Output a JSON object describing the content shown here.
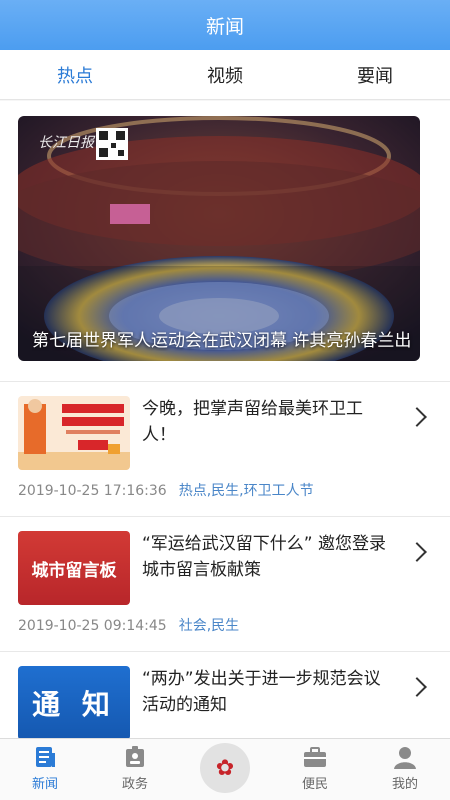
{
  "header": {
    "title": "新闻"
  },
  "tabs": [
    {
      "label": "热点",
      "active": true
    },
    {
      "label": "视频",
      "active": false
    },
    {
      "label": "要闻",
      "active": false
    }
  ],
  "hero": {
    "caption": "第七届世界军人运动会在武汉闭幕 许其亮孙春兰出",
    "logo_text": "长江日报"
  },
  "news": [
    {
      "title": "今晚，把掌声留给最美环卫工人！",
      "time": "2019-10-25 17:16:36",
      "tags": "热点,民生,环卫工人节",
      "thumb": "sanitation-worker-poster"
    },
    {
      "title": "“军运给武汉留下什么” 邀您登录城市留言板献策",
      "time": "2019-10-25 09:14:45",
      "tags": "社会,民生",
      "thumb": "city-message-board",
      "thumb_text": "城市留言板"
    },
    {
      "title": "“两办”发出关于进一步规范会议活动的通知",
      "time": "",
      "tags": "",
      "thumb": "notice-banner",
      "thumb_text": "通 知"
    }
  ],
  "tabbar": [
    {
      "label": "新闻",
      "icon": "news-icon",
      "active": true
    },
    {
      "label": "政务",
      "icon": "gov-affairs-icon",
      "active": false
    },
    {
      "label": "",
      "icon": "center-logo-icon",
      "active": false
    },
    {
      "label": "便民",
      "icon": "briefcase-icon",
      "active": false
    },
    {
      "label": "我的",
      "icon": "user-icon",
      "active": false
    }
  ],
  "colors": {
    "header": "#4c9df0",
    "accent": "#2b7bd6",
    "tag": "#4a86c8"
  }
}
